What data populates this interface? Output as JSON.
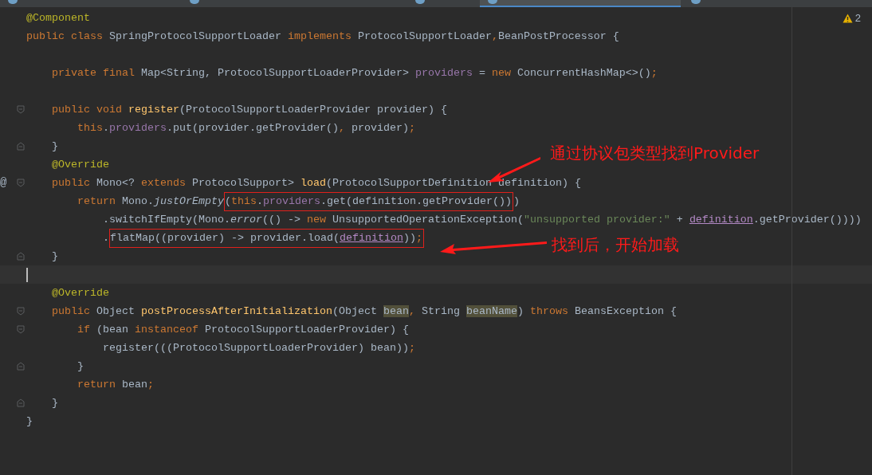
{
  "tabs": [
    {
      "selected": false
    },
    {
      "selected": false
    },
    {
      "selected": false
    },
    {
      "selected": true
    },
    {
      "selected": false
    }
  ],
  "warnings": {
    "count": "2"
  },
  "lines": [
    {
      "current": false,
      "tokens": [
        {
          "t": "@Component",
          "kind": "ann"
        }
      ]
    },
    {
      "current": false,
      "tokens": [
        {
          "t": "public class ",
          "kind": "kw"
        },
        {
          "t": "SpringProtocolSupportLoader ",
          "kind": "plain"
        },
        {
          "t": "implements ",
          "kind": "kw"
        },
        {
          "t": "ProtocolSupportLoader",
          "kind": "plain"
        },
        {
          "t": ",",
          "kind": "kw"
        },
        {
          "t": "BeanPostProcessor {",
          "kind": "plain"
        }
      ]
    },
    {
      "current": false
    },
    {
      "current": false,
      "tokens": [
        {
          "t": "    private final ",
          "kind": "kw"
        },
        {
          "t": "Map<String, ProtocolSupportLoaderProvider> ",
          "kind": "plain"
        },
        {
          "t": "providers",
          "kind": "field"
        },
        {
          "t": " = ",
          "kind": "plain"
        },
        {
          "t": "new ",
          "kind": "kw"
        },
        {
          "t": "ConcurrentHashMap<>()",
          "kind": "plain"
        },
        {
          "t": ";",
          "kind": "kw"
        }
      ]
    },
    {
      "current": false
    },
    {
      "current": false,
      "fold": {
        "kind": "open"
      },
      "tokens": [
        {
          "t": "    public void ",
          "kind": "kw"
        },
        {
          "t": "register",
          "kind": "method"
        },
        {
          "t": "(ProtocolSupportLoaderProvider provider) {",
          "kind": "plain"
        }
      ]
    },
    {
      "current": false,
      "tokens": [
        {
          "t": "        this",
          "kind": "kw"
        },
        {
          "t": ".",
          "kind": "plain"
        },
        {
          "t": "providers",
          "kind": "field"
        },
        {
          "t": ".put(provider.getProvider()",
          "kind": "plain"
        },
        {
          "t": ", ",
          "kind": "kw"
        },
        {
          "t": "provider)",
          "kind": "plain"
        },
        {
          "t": ";",
          "kind": "kw"
        }
      ]
    },
    {
      "current": false,
      "fold": {
        "kind": "close"
      },
      "tokens": [
        {
          "t": "    }",
          "kind": "plain"
        }
      ]
    },
    {
      "current": false,
      "tokens": [
        {
          "t": "    @Override",
          "kind": "ann"
        }
      ]
    },
    {
      "current": false,
      "fold": {
        "kind": "open"
      },
      "gutter": "@",
      "tokens": [
        {
          "t": "    public ",
          "kind": "kw"
        },
        {
          "t": "Mono<? ",
          "kind": "plain"
        },
        {
          "t": "extends ",
          "kind": "kw"
        },
        {
          "t": "ProtocolSupport> ",
          "kind": "plain"
        },
        {
          "t": "load",
          "kind": "method"
        },
        {
          "t": "(ProtocolSupportDefinition definition) {",
          "kind": "plain"
        }
      ]
    },
    {
      "current": false,
      "segments": [
        {
          "framed": false,
          "tokens": [
            {
              "t": "        return ",
              "kind": "kw"
            },
            {
              "t": "Mono.",
              "kind": "plain"
            },
            {
              "t": "justOrEmpty",
              "kind": "italic"
            }
          ]
        },
        {
          "framed": true,
          "tokens": [
            {
              "t": "(",
              "kind": "plain"
            },
            {
              "t": "this",
              "kind": "kw"
            },
            {
              "t": ".",
              "kind": "plain"
            },
            {
              "t": "providers",
              "kind": "field"
            },
            {
              "t": ".get(definition.getProvider())",
              "kind": "plain"
            }
          ]
        },
        {
          "framed": false,
          "tokens": [
            {
              "t": ")",
              "kind": "plain"
            }
          ]
        }
      ]
    },
    {
      "current": false,
      "tokens": [
        {
          "t": "            .switchIfEmpty(Mono.",
          "kind": "plain"
        },
        {
          "t": "error",
          "kind": "italic"
        },
        {
          "t": "(() -> ",
          "kind": "plain"
        },
        {
          "t": "new ",
          "kind": "kw"
        },
        {
          "t": "UnsupportedOperationException(",
          "kind": "plain"
        },
        {
          "t": "\"unsupported provider:\"",
          "kind": "str"
        },
        {
          "t": " + ",
          "kind": "plain"
        },
        {
          "t": "definition",
          "kind": "param"
        },
        {
          "t": ".getProvider())))",
          "kind": "plain"
        }
      ]
    },
    {
      "current": false,
      "segments": [
        {
          "framed": false,
          "tokens": [
            {
              "t": "            .",
              "kind": "plain"
            }
          ]
        },
        {
          "framed": true,
          "tokens": [
            {
              "t": "flatMap((provider) -> provider.load(",
              "kind": "plain"
            },
            {
              "t": "definition",
              "kind": "param"
            },
            {
              "t": "))",
              "kind": "plain"
            },
            {
              "t": ";",
              "kind": "kw"
            }
          ]
        }
      ]
    },
    {
      "current": false,
      "fold": {
        "kind": "close"
      },
      "tokens": [
        {
          "t": "    }",
          "kind": "plain"
        }
      ]
    },
    {
      "current": true
    },
    {
      "current": false,
      "tokens": [
        {
          "t": "    @Override",
          "kind": "ann"
        }
      ]
    },
    {
      "current": false,
      "fold": {
        "kind": "open"
      },
      "tokens": [
        {
          "t": "    public ",
          "kind": "kw"
        },
        {
          "t": "Object ",
          "kind": "plain"
        },
        {
          "t": "postProcessAfterInitialization",
          "kind": "method"
        },
        {
          "t": "(Object ",
          "kind": "plain"
        },
        {
          "t": "bean",
          "kind": "hl"
        },
        {
          "t": ", ",
          "kind": "kw"
        },
        {
          "t": "String ",
          "kind": "plain"
        },
        {
          "t": "beanName",
          "kind": "hl"
        },
        {
          "t": ") ",
          "kind": "plain"
        },
        {
          "t": "throws ",
          "kind": "kw"
        },
        {
          "t": "BeansException {",
          "kind": "plain"
        }
      ]
    },
    {
      "current": false,
      "fold": {
        "kind": "open"
      },
      "tokens": [
        {
          "t": "        if ",
          "kind": "kw"
        },
        {
          "t": "(bean ",
          "kind": "plain"
        },
        {
          "t": "instanceof ",
          "kind": "kw"
        },
        {
          "t": "ProtocolSupportLoaderProvider) {",
          "kind": "plain"
        }
      ]
    },
    {
      "current": false,
      "tokens": [
        {
          "t": "            register(((ProtocolSupportLoaderProvider) bean))",
          "kind": "plain"
        },
        {
          "t": ";",
          "kind": "kw"
        }
      ]
    },
    {
      "current": false,
      "fold": {
        "kind": "close"
      },
      "tokens": [
        {
          "t": "        }",
          "kind": "plain"
        }
      ]
    },
    {
      "current": false,
      "tokens": [
        {
          "t": "        return ",
          "kind": "kw"
        },
        {
          "t": "bean",
          "kind": "plain"
        },
        {
          "t": ";",
          "kind": "kw"
        }
      ]
    },
    {
      "current": false,
      "fold": {
        "kind": "close"
      },
      "tokens": [
        {
          "t": "    }",
          "kind": "plain"
        }
      ]
    },
    {
      "current": false,
      "tokens": [
        {
          "t": "}",
          "kind": "plain"
        }
      ]
    }
  ],
  "annotations": [
    {
      "text": "通过协议包类型找到Provider"
    },
    {
      "text": "找到后，开始加载"
    }
  ]
}
